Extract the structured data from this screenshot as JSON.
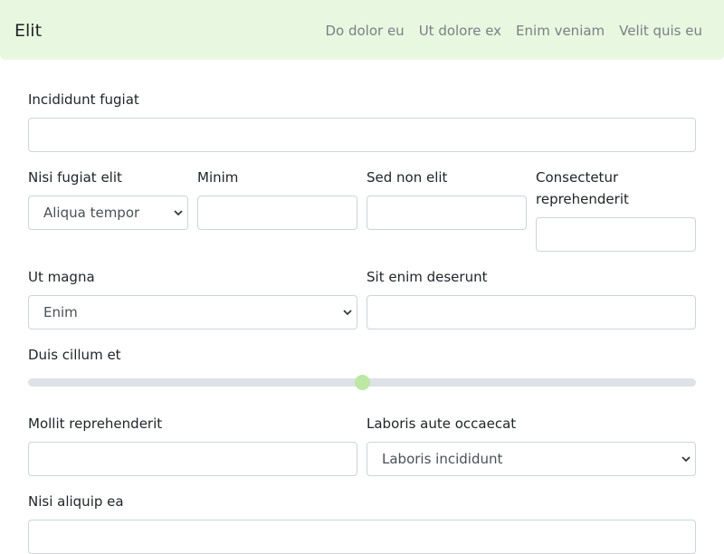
{
  "navbar": {
    "brand": "Elit",
    "links": [
      "Do dolor eu",
      "Ut dolore ex",
      "Enim veniam",
      "Velit quis eu"
    ]
  },
  "form": {
    "field1": {
      "label": "Incididunt fugiat",
      "value": ""
    },
    "field2": {
      "label": "Nisi fugiat elit",
      "selected": "Aliqua tempor"
    },
    "field3": {
      "label": "Minim",
      "value": ""
    },
    "field4": {
      "label": "Sed non elit",
      "value": ""
    },
    "field5": {
      "label_line1": "Consectetur",
      "label_line2": "reprehenderit",
      "value": ""
    },
    "field6": {
      "label": "Ut magna",
      "selected": "Enim"
    },
    "field7": {
      "label": "Sit enim deserunt",
      "value": ""
    },
    "field8": {
      "label": "Duis cillum et",
      "value_fraction": 0.5
    },
    "field9": {
      "label": "Mollit reprehenderit",
      "value": ""
    },
    "field10": {
      "label": "Laboris aute occaecat",
      "selected": "Laboris incididunt"
    },
    "field11": {
      "label": "Nisi aliquip ea",
      "value": ""
    }
  },
  "colors": {
    "navbar_bg": "#e8f8e0",
    "slider_thumb": "#bce8a4",
    "slider_track": "#dee2e6"
  },
  "icons": {
    "select_arrow": "chevron-down-icon"
  }
}
